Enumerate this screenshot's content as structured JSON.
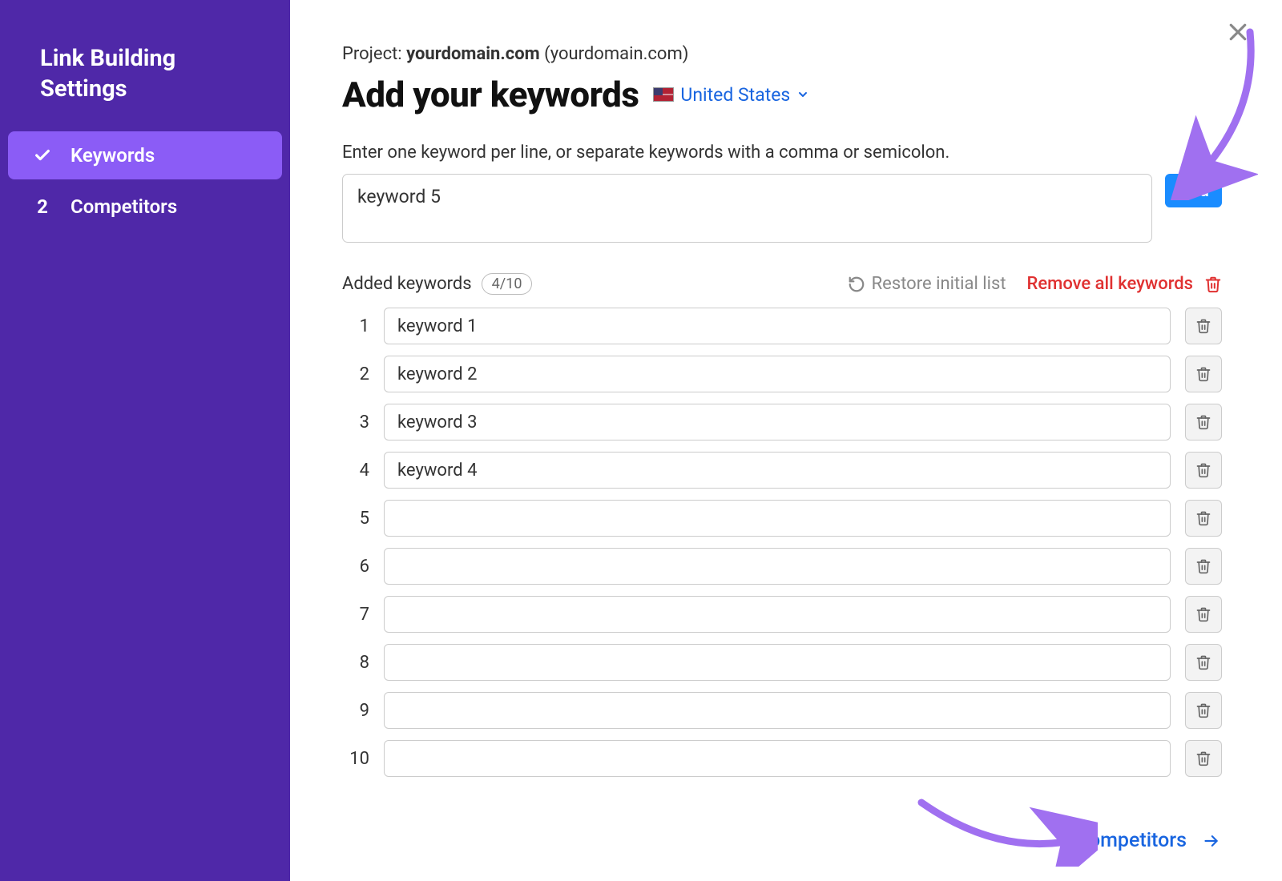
{
  "sidebar": {
    "title": "Link Building Settings",
    "items": [
      {
        "indicator": "check",
        "label": "Keywords",
        "active": true
      },
      {
        "indicator": "2",
        "label": "Competitors",
        "active": false
      }
    ]
  },
  "header": {
    "project_prefix": "Project: ",
    "project_domain": "yourdomain.com",
    "project_suffix": " (yourdomain.com)",
    "title": "Add your keywords",
    "country": "United States"
  },
  "instruction": "Enter one keyword per line, or separate keywords with a comma or semicolon.",
  "input_value": "keyword 5",
  "add_label": "Add",
  "list": {
    "heading": "Added keywords",
    "count_badge": "4/10",
    "restore": "Restore initial list",
    "remove_all": "Remove all keywords"
  },
  "rows": [
    {
      "n": "1",
      "v": "keyword 1"
    },
    {
      "n": "2",
      "v": "keyword 2"
    },
    {
      "n": "3",
      "v": "keyword 3"
    },
    {
      "n": "4",
      "v": "keyword 4"
    },
    {
      "n": "5",
      "v": ""
    },
    {
      "n": "6",
      "v": ""
    },
    {
      "n": "7",
      "v": ""
    },
    {
      "n": "8",
      "v": ""
    },
    {
      "n": "9",
      "v": ""
    },
    {
      "n": "10",
      "v": ""
    }
  ],
  "footer": {
    "next": "Competitors"
  },
  "colors": {
    "sidebar": "#4f28a8",
    "sidebar_active": "#8b5cf6",
    "primary_blue": "#1a8cff",
    "link_blue": "#1965e0",
    "danger": "#e03131",
    "annotation": "#a070f0"
  }
}
